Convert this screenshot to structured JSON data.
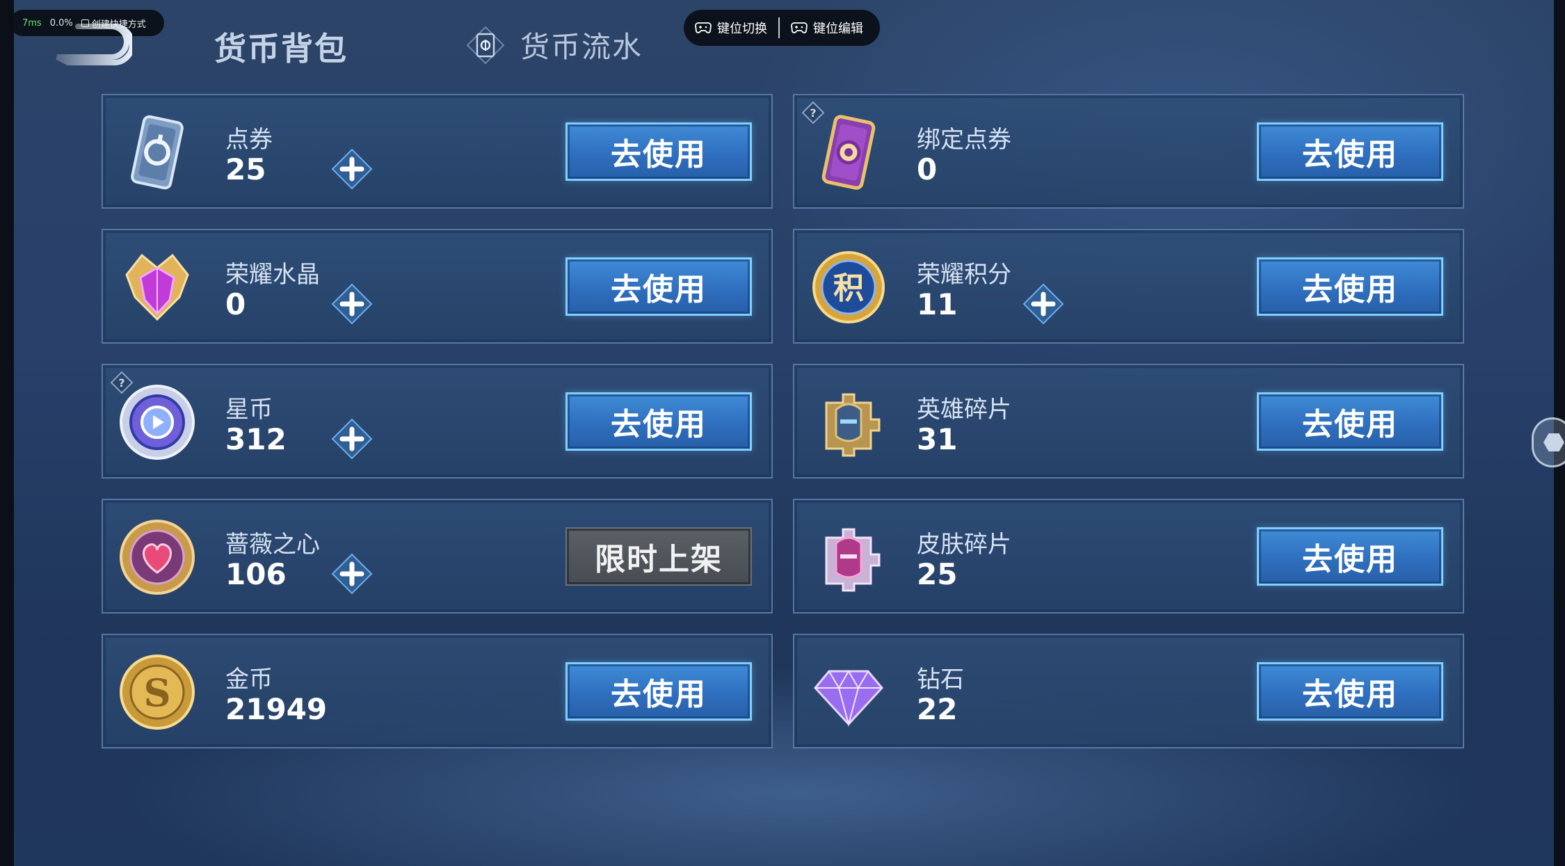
{
  "overlay": {
    "latency": "7ms",
    "cpu": "0.0%",
    "shortcut_label": "创建快捷方式"
  },
  "keybar": {
    "switch_label": "键位切换",
    "edit_label": "键位编辑"
  },
  "header": {
    "title": "货币背包",
    "tab_flow": "货币流水"
  },
  "colors": {
    "button_blue": "#3f8bd6",
    "button_border": "#7fd0ff",
    "button_gray": "#52585e",
    "card_bg": "#2e4e78"
  },
  "currencies": [
    {
      "name": "点券",
      "value": "25",
      "icon": "coupon-card-icon",
      "has_plus": true,
      "has_help": false,
      "button": "去使用",
      "button_style": "blue"
    },
    {
      "name": "绑定点券",
      "value": "0",
      "icon": "bound-coupon-card-icon",
      "has_plus": false,
      "has_help": true,
      "button": "去使用",
      "button_style": "blue"
    },
    {
      "name": "荣耀水晶",
      "value": "0",
      "icon": "glory-crystal-icon",
      "has_plus": true,
      "has_help": false,
      "button": "去使用",
      "button_style": "blue"
    },
    {
      "name": "荣耀积分",
      "value": "11",
      "icon": "glory-points-icon",
      "has_plus": true,
      "has_help": false,
      "button": "去使用",
      "button_style": "blue"
    },
    {
      "name": "星币",
      "value": "312",
      "icon": "star-coin-icon",
      "has_plus": true,
      "has_help": true,
      "button": "去使用",
      "button_style": "blue"
    },
    {
      "name": "英雄碎片",
      "value": "31",
      "icon": "hero-fragment-icon",
      "has_plus": false,
      "has_help": false,
      "button": "去使用",
      "button_style": "blue"
    },
    {
      "name": "蔷薇之心",
      "value": "106",
      "icon": "rose-heart-icon",
      "has_plus": true,
      "has_help": false,
      "button": "限时上架",
      "button_style": "gray"
    },
    {
      "name": "皮肤碎片",
      "value": "25",
      "icon": "skin-fragment-icon",
      "has_plus": false,
      "has_help": false,
      "button": "去使用",
      "button_style": "blue"
    },
    {
      "name": "金币",
      "value": "21949",
      "icon": "gold-coin-icon",
      "has_plus": false,
      "has_help": false,
      "button": "去使用",
      "button_style": "blue"
    },
    {
      "name": "钻石",
      "value": "22",
      "icon": "diamond-icon",
      "has_plus": false,
      "has_help": false,
      "button": "去使用",
      "button_style": "blue"
    }
  ]
}
